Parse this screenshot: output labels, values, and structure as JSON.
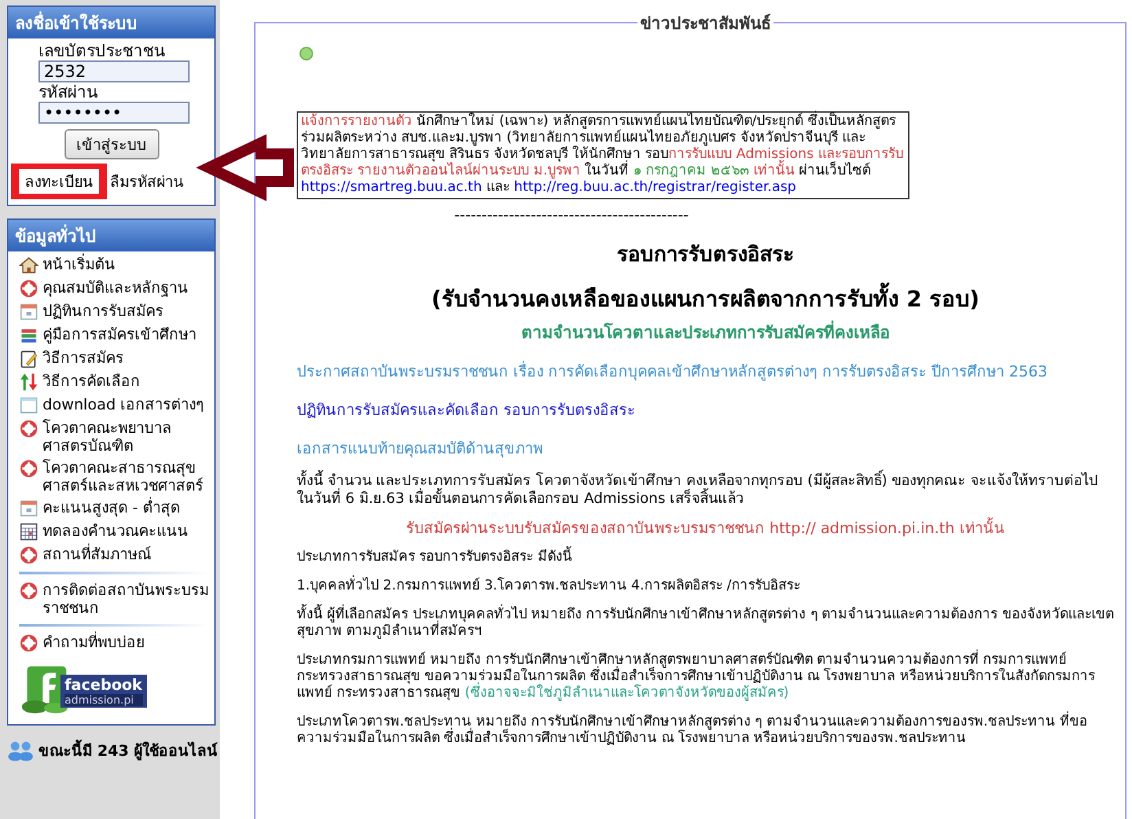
{
  "login": {
    "title": "ลงชื่อเข้าใช้ระบบ",
    "id_label": "เลขบัตรประชาชน",
    "id_value": "2532",
    "password_label": "รหัสผ่าน",
    "password_value": "••••••••",
    "submit": "เข้าสู่ระบบ",
    "register_link": {
      "label": "ลงทะเบียน",
      "highlighted": true
    },
    "forgot_link": "ลืมรหัสผ่าน"
  },
  "info": {
    "title": "ข้อมูลทั่วไป",
    "menu_groups": [
      [
        {
          "kind": "home",
          "label": "หน้าเริ่มต้น"
        },
        {
          "kind": "ring",
          "label": "คุณสมบัติและหลักฐาน"
        },
        {
          "kind": "calendar",
          "label": "ปฏิทินการรับสมัคร"
        },
        {
          "kind": "books",
          "label": "คู่มือการสมัครเข้าศึกษา"
        },
        {
          "kind": "note",
          "label": "วิธีการสมัคร"
        },
        {
          "kind": "arrows",
          "label": "วิธีการคัดเลือก"
        },
        {
          "kind": "window",
          "label": "download เอกสารต่างๆ"
        },
        {
          "kind": "ring",
          "label": "โควตาคณะพยาบาลศาสตรบัณฑิต"
        },
        {
          "kind": "ring",
          "label": "โควตาคณะสาธารณสุขศาสตร์และสหเวชศาสตร์"
        },
        {
          "kind": "calendar",
          "label": "คะแนนสูงสุด - ต่ำสุด"
        },
        {
          "kind": "table",
          "label": "ทดลองคำนวณคะแนน"
        },
        {
          "kind": "ring",
          "label": "สถานที่สัมภาษณ์"
        }
      ],
      [
        {
          "kind": "ring",
          "label": "การติดต่อสถาบันพระบรมราชชนก"
        }
      ],
      [
        {
          "kind": "ring",
          "label": "คำถามที่พบบ่อย"
        }
      ]
    ],
    "banner": {
      "title": "facebook",
      "subtitle": "admission.pi"
    }
  },
  "online": "ขณะนี้มี 243 ผู้ใช้ออนไลน์",
  "news": {
    "legend": "ข่าวประชาสัมพันธ์",
    "notice": [
      {
        "color": "#d23c3c",
        "text": "แจ้งการรายงานตัว"
      },
      {
        "color": "#000000",
        "text": " นักศึกษาใหม่ (เฉพาะ) หลักสูตรการแพทย์แผนไทยบัณฑิต/ประยุกต์ ซึ่งเป็นหลักสูตรร่วมผลิตระหว่าง สบช.และม.บูรพา (วิทยาลัยการแพทย์แผนไทยอภัยภูเบศร จังหวัดปราจีนบุรี และวิทยาลัยการสาธารณสุข สิรินธร จังหวัดชลบุรี ให้นักศึกษา รอบ"
      },
      {
        "color": "#d23c3c",
        "text": "การรับแบบ Admissions และรอบการรับตรงอิสระ รายงานตัวออนไลน์ผ่านระบบ ม.บูรพา"
      },
      {
        "color": "#000000",
        "text": " ในวันที่ "
      },
      {
        "color": "#2e9a3a",
        "text": "๑ กรกฎาคม ๒๕๖๓"
      },
      {
        "color": "#d23c3c",
        "text": " เท่านั้น"
      },
      {
        "color": "#000000",
        "text": " ผ่านเว็บไซต์ "
      },
      {
        "color": "#0000ee",
        "text": "https://smartreg.buu.ac.th"
      },
      {
        "color": "#000000",
        "text": " และ "
      },
      {
        "color": "#0000ee",
        "text": "http://reg.buu.ac.th/registrar/register.asp"
      }
    ],
    "separator": "-------------------------------------------",
    "heading": "รอบการรับตรงอิสระ",
    "subheading": "(รับจำนวนคงเหลือของแผนการผลิตจากการรับทั้ง 2 รอบ)",
    "tagline": "ตามจำนวนโควตาและประเภทการรับสมัครที่คงเหลือ",
    "paragraphs": [
      {
        "kind": "link",
        "parts": [
          {
            "color": "#3a8fd0",
            "text": "ประกาศสถาบันพระบรมราชชนก เรื่อง การคัดเลือกบุคคลเข้าศึกษาหลักสูตรต่างๆ การรับตรงอิสระ ปีการศึกษา 2563"
          }
        ]
      },
      {
        "kind": "link",
        "parts": [
          {
            "color": "#1a1acc",
            "text": "ปฏิทินการรับสมัครและคัดเลือก รอบการรับตรงอิสระ"
          }
        ]
      },
      {
        "kind": "link",
        "parts": [
          {
            "color": "#3a8fd0",
            "text": "เอกสารแนบท้ายคุณสมบัติด้านสุขภาพ"
          }
        ]
      },
      {
        "kind": "large",
        "parts": [
          {
            "color": "#000000",
            "text": "ทั้งนี้ จำนวน และประเภทการรับสมัคร โควตาจังหวัดเข้าศึกษา คงเหลือจากทุกรอบ (มีผู้สละสิทธิ์) ของทุกคณะ จะแจ้งให้ทราบต่อไปในวันที่ 6 มิ.ย.63 เมื่อขั้นตอนการคัดเลือกรอบ Admissions  เสร็จสิ้นแล้ว"
          }
        ]
      },
      {
        "kind": "center",
        "parts": [
          {
            "color": "#d23c3c",
            "text": "รับสมัครผ่านระบบรับสมัครของสถาบันพระบรมราชชนก http:// admission.pi.in.th เท่านั้น"
          }
        ]
      },
      {
        "kind": "text",
        "parts": [
          {
            "color": "#000000",
            "text": "ประเภทการรับสมัคร รอบการรับตรงอิสระ มีดังนี้"
          }
        ]
      },
      {
        "kind": "text",
        "parts": [
          {
            "color": "#000000",
            "text": " 1.บุคคลทั่วไป 2.กรมการแพทย์ 3.โควตารพ.ชลประทาน 4.การผลิตอิสระ /การรับอิสระ"
          }
        ]
      },
      {
        "kind": "text",
        "parts": [
          {
            "color": "#000000",
            "text": "ทั้งนี้ ผู้ที่เลือกสมัคร ประเภทบุคคลทั่วไป หมายถึง การรับนักศึกษาเข้าศึกษาหลักสูตรต่าง ๆ ตามจำนวนและความต้องการ   ของจังหวัดและเขตสุขภาพ ตามภูมิลำเนาที่สมัครฯ"
          }
        ]
      },
      {
        "kind": "text",
        "parts": [
          {
            "color": "#000000",
            "text": "ประเภทกรมการแพทย์  หมายถึง  การรับนักศึกษาเข้าศึกษาหลักสูตรพยาบาลศาสตร์บัณฑิต ตามจำนวนความต้องการที่     กรมการแพทย์ กระทรวงสาธารณสุข ขอความร่วมมือในการผลิต ซึ่งเมื่อสำเร็จการศึกษาเข้าปฏิบัติงาน ณ โรงพยาบาล หรือหน่วยบริการในสังกัดกรมการแพทย์ กระทรวงสาธารณสุข "
          },
          {
            "color": "#2aa38a",
            "text": "(ซึ่งอาจจะมิใช่ภูมิลำเนาและโควตาจังหวัดของผู้สมัคร)"
          }
        ]
      },
      {
        "kind": "text",
        "parts": [
          {
            "color": "#000000",
            "text": "ประเภทโควตารพ.ชลประทาน หมายถึง การรับนักศึกษาเข้าศึกษาหลักสูตรต่าง ๆ ตามจำนวนและความต้องการของรพ.ชลประทาน ที่ขอความร่วมมือในการผลิต ซึ่งเมื่อสำเร็จการศึกษาเข้าปฏิบัติงาน ณ โรงพยาบาล หรือหน่วยบริการของรพ.ชลประทาน"
          }
        ]
      }
    ]
  }
}
